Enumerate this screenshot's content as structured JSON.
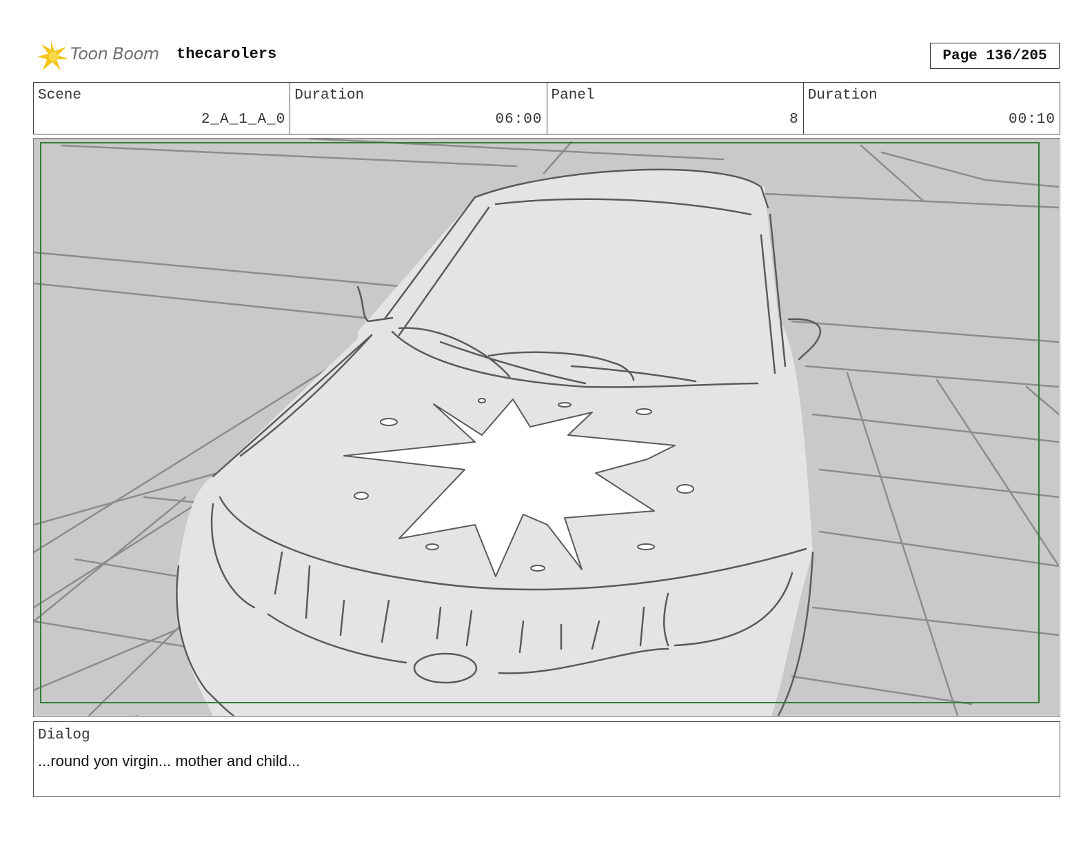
{
  "header": {
    "logo_text": "Toon Boom",
    "project_title": "thecarolers",
    "page_label": "Page 136/205"
  },
  "info": {
    "scene_label": "Scene",
    "scene_value": "2_A_1_A_0",
    "duration_label": "Duration",
    "duration_value": "06:00",
    "panel_label": "Panel",
    "panel_value": "8",
    "panel_duration_label": "Duration",
    "panel_duration_value": "00:10"
  },
  "panel_image": {
    "icon": "storyboard-sketch-car-hood-star",
    "colors": {
      "background": "#c9c9c9",
      "car_fill": "#e4e4e4",
      "line": "#5a5a5a",
      "safe_frame": "#2e7d32"
    }
  },
  "dialog": {
    "label": "Dialog",
    "text": "...round yon virgin... mother and child..."
  }
}
